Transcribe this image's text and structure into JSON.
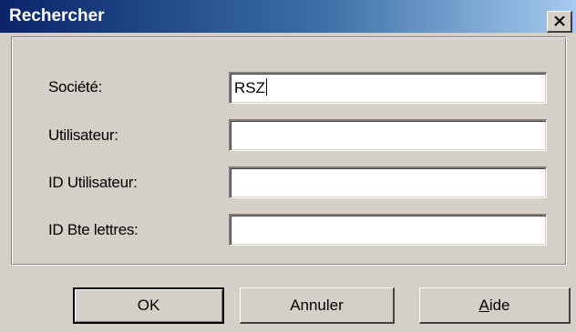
{
  "window": {
    "title": "Rechercher",
    "close_icon": "close-icon"
  },
  "form": {
    "fields": [
      {
        "label": "Société:",
        "value": "RSZ",
        "placeholder": ""
      },
      {
        "label": "Utilisateur:",
        "value": "",
        "placeholder": ""
      },
      {
        "label": "ID Utilisateur:",
        "value": "",
        "placeholder": ""
      },
      {
        "label": "ID Bte lettres:",
        "value": "",
        "placeholder": ""
      }
    ]
  },
  "buttons": {
    "ok_label": "OK",
    "cancel_label": "Annuler",
    "help_label_accel": "A",
    "help_label_rest": "ide"
  },
  "colors": {
    "titlebar_start": "#0a246a",
    "titlebar_end": "#a6caf0",
    "dialog_face": "#d4d0c8"
  }
}
